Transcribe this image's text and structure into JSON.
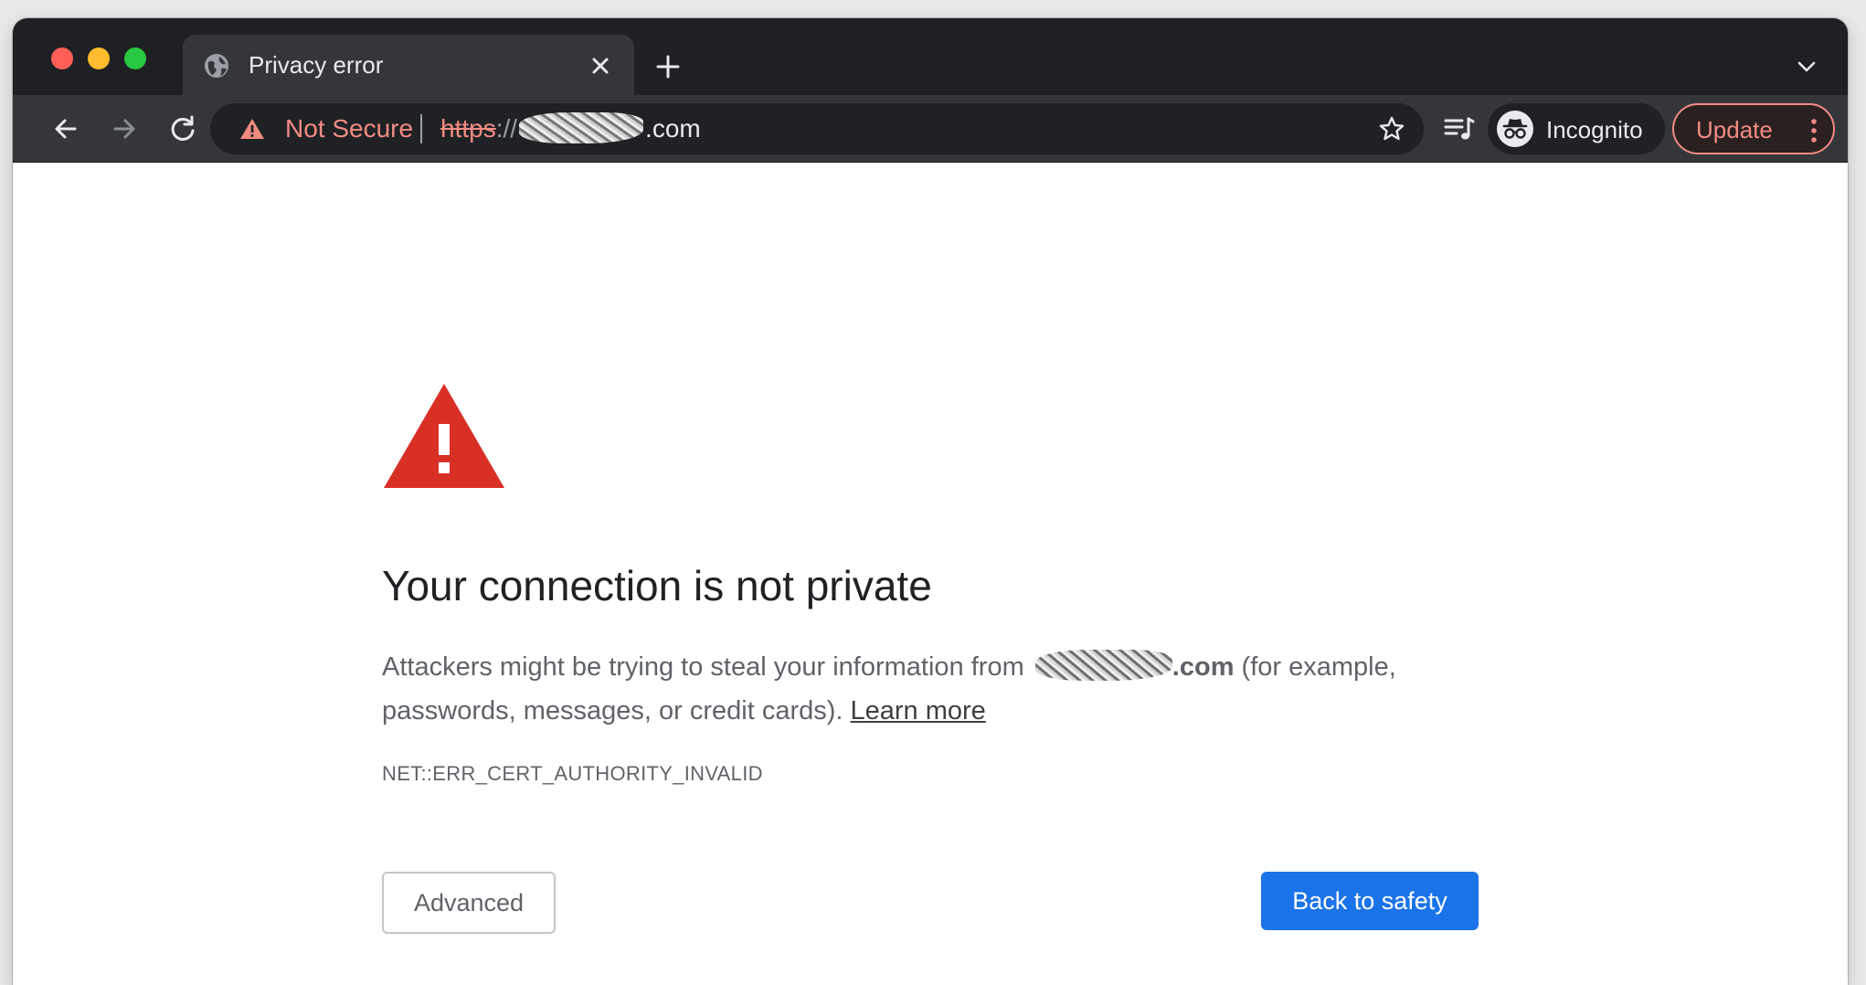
{
  "tab": {
    "title": "Privacy error"
  },
  "omnibox": {
    "security_label": "Not Secure",
    "url_scheme": "https",
    "url_separator": "://",
    "url_tld": ".com"
  },
  "toolbar": {
    "profile_label": "Incognito",
    "update_label": "Update"
  },
  "page": {
    "headline": "Your connection is not private",
    "body_prefix": "Attackers might be trying to steal your information from ",
    "domain_suffix": ".com",
    "body_suffix": " (for example, passwords, messages, or credit cards). ",
    "learn_more": "Learn more",
    "error_code": "NET::ERR_CERT_AUTHORITY_INVALID",
    "advanced_button": "Advanced",
    "back_button": "Back to safety"
  },
  "colors": {
    "tabstrip_bg": "#1f2023",
    "toolbar_bg": "#35363a",
    "warning_red": "#d93025",
    "not_secure_red": "#f28b82",
    "primary_blue": "#1a73e8"
  },
  "icons": [
    "globe-icon",
    "close-icon",
    "plus-icon",
    "chevron-down-icon",
    "back-arrow-icon",
    "forward-arrow-icon",
    "reload-icon",
    "warning-icon",
    "star-icon",
    "reading-list-icon",
    "incognito-icon",
    "more-vert-icon",
    "warning-triangle-icon"
  ]
}
